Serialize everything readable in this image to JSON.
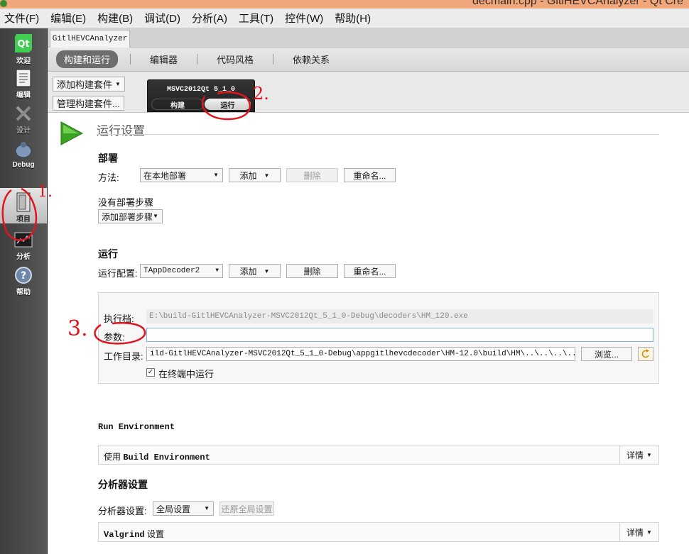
{
  "window": {
    "title": "decmain.cpp - GitlHEVCAnalyzer - Qt Cre"
  },
  "menu": [
    "文件(F)",
    "编辑(E)",
    "构建(B)",
    "调试(D)",
    "分析(A)",
    "工具(T)",
    "控件(W)",
    "帮助(H)"
  ],
  "modes": [
    {
      "label": "欢迎",
      "icon": "qt-logo-icon"
    },
    {
      "label": "编辑",
      "icon": "document-icon"
    },
    {
      "label": "设计",
      "icon": "design-tools-icon"
    },
    {
      "label": "Debug",
      "icon": "bug-icon"
    },
    {
      "label": "项目",
      "icon": "folder-project-icon",
      "active": true
    },
    {
      "label": "分析",
      "icon": "analyze-screen-icon"
    },
    {
      "label": "帮助",
      "icon": "help-icon"
    }
  ],
  "project_tab": "GitlHEVCAnalyzer",
  "subtabs": [
    "构建和运行",
    "编辑器",
    "代码风格",
    "依赖关系"
  ],
  "kits": {
    "add_kit": "添加构建套件",
    "manage_kits": "管理构建套件...",
    "kit_name": "MSVC2012Qt 5_1_0",
    "build_tab": "构建",
    "run_tab": "运行"
  },
  "run_settings": {
    "title": "运行设置",
    "deploy": {
      "heading": "部署",
      "method_label": "方法:",
      "method_value": "在本地部署",
      "add": "添加",
      "delete": "删除",
      "rename": "重命名...",
      "no_steps": "没有部署步骤",
      "add_step": "添加部署步骤"
    },
    "run": {
      "heading": "运行",
      "config_label": "运行配置:",
      "config_value": "TAppDecoder2",
      "add": "添加",
      "delete": "删除",
      "rename": "重命名..."
    },
    "executable": {
      "label": "执行档:",
      "value": "E:\\build-GitlHEVCAnalyzer-MSVC2012Qt_5_1_0-Debug\\decoders\\HM_120.exe"
    },
    "arguments": {
      "label": "参数:",
      "value": ""
    },
    "workdir": {
      "label": "工作目录:",
      "value": "ild-GitlHEVCAnalyzer-MSVC2012Qt_5_1_0-Debug\\appgitlhevcdecoder\\HM-12.0\\build\\HM\\..\\..\\..\\..\\decoders",
      "browse": "浏览..."
    },
    "run_in_terminal": {
      "label": "在终端中运行",
      "checked": "✓"
    },
    "environment": {
      "heading": "Run Environment",
      "use_prefix": "使用",
      "use_value": "Build Environment",
      "details": "详情"
    },
    "analyzer": {
      "heading": "分析器设置",
      "settings_label": "分析器设置:",
      "settings_value": "全局设置",
      "restore": "还原全局设置",
      "valgrind_name": "Valgrind",
      "valgrind_suffix": "设置",
      "details": "详情"
    }
  },
  "annotations": [
    "1.",
    "2.",
    "3."
  ],
  "colors": {
    "annotation_red": "#e0141e",
    "run_green": "#3ba324",
    "sidebar_dark": "#4a4a4a"
  }
}
